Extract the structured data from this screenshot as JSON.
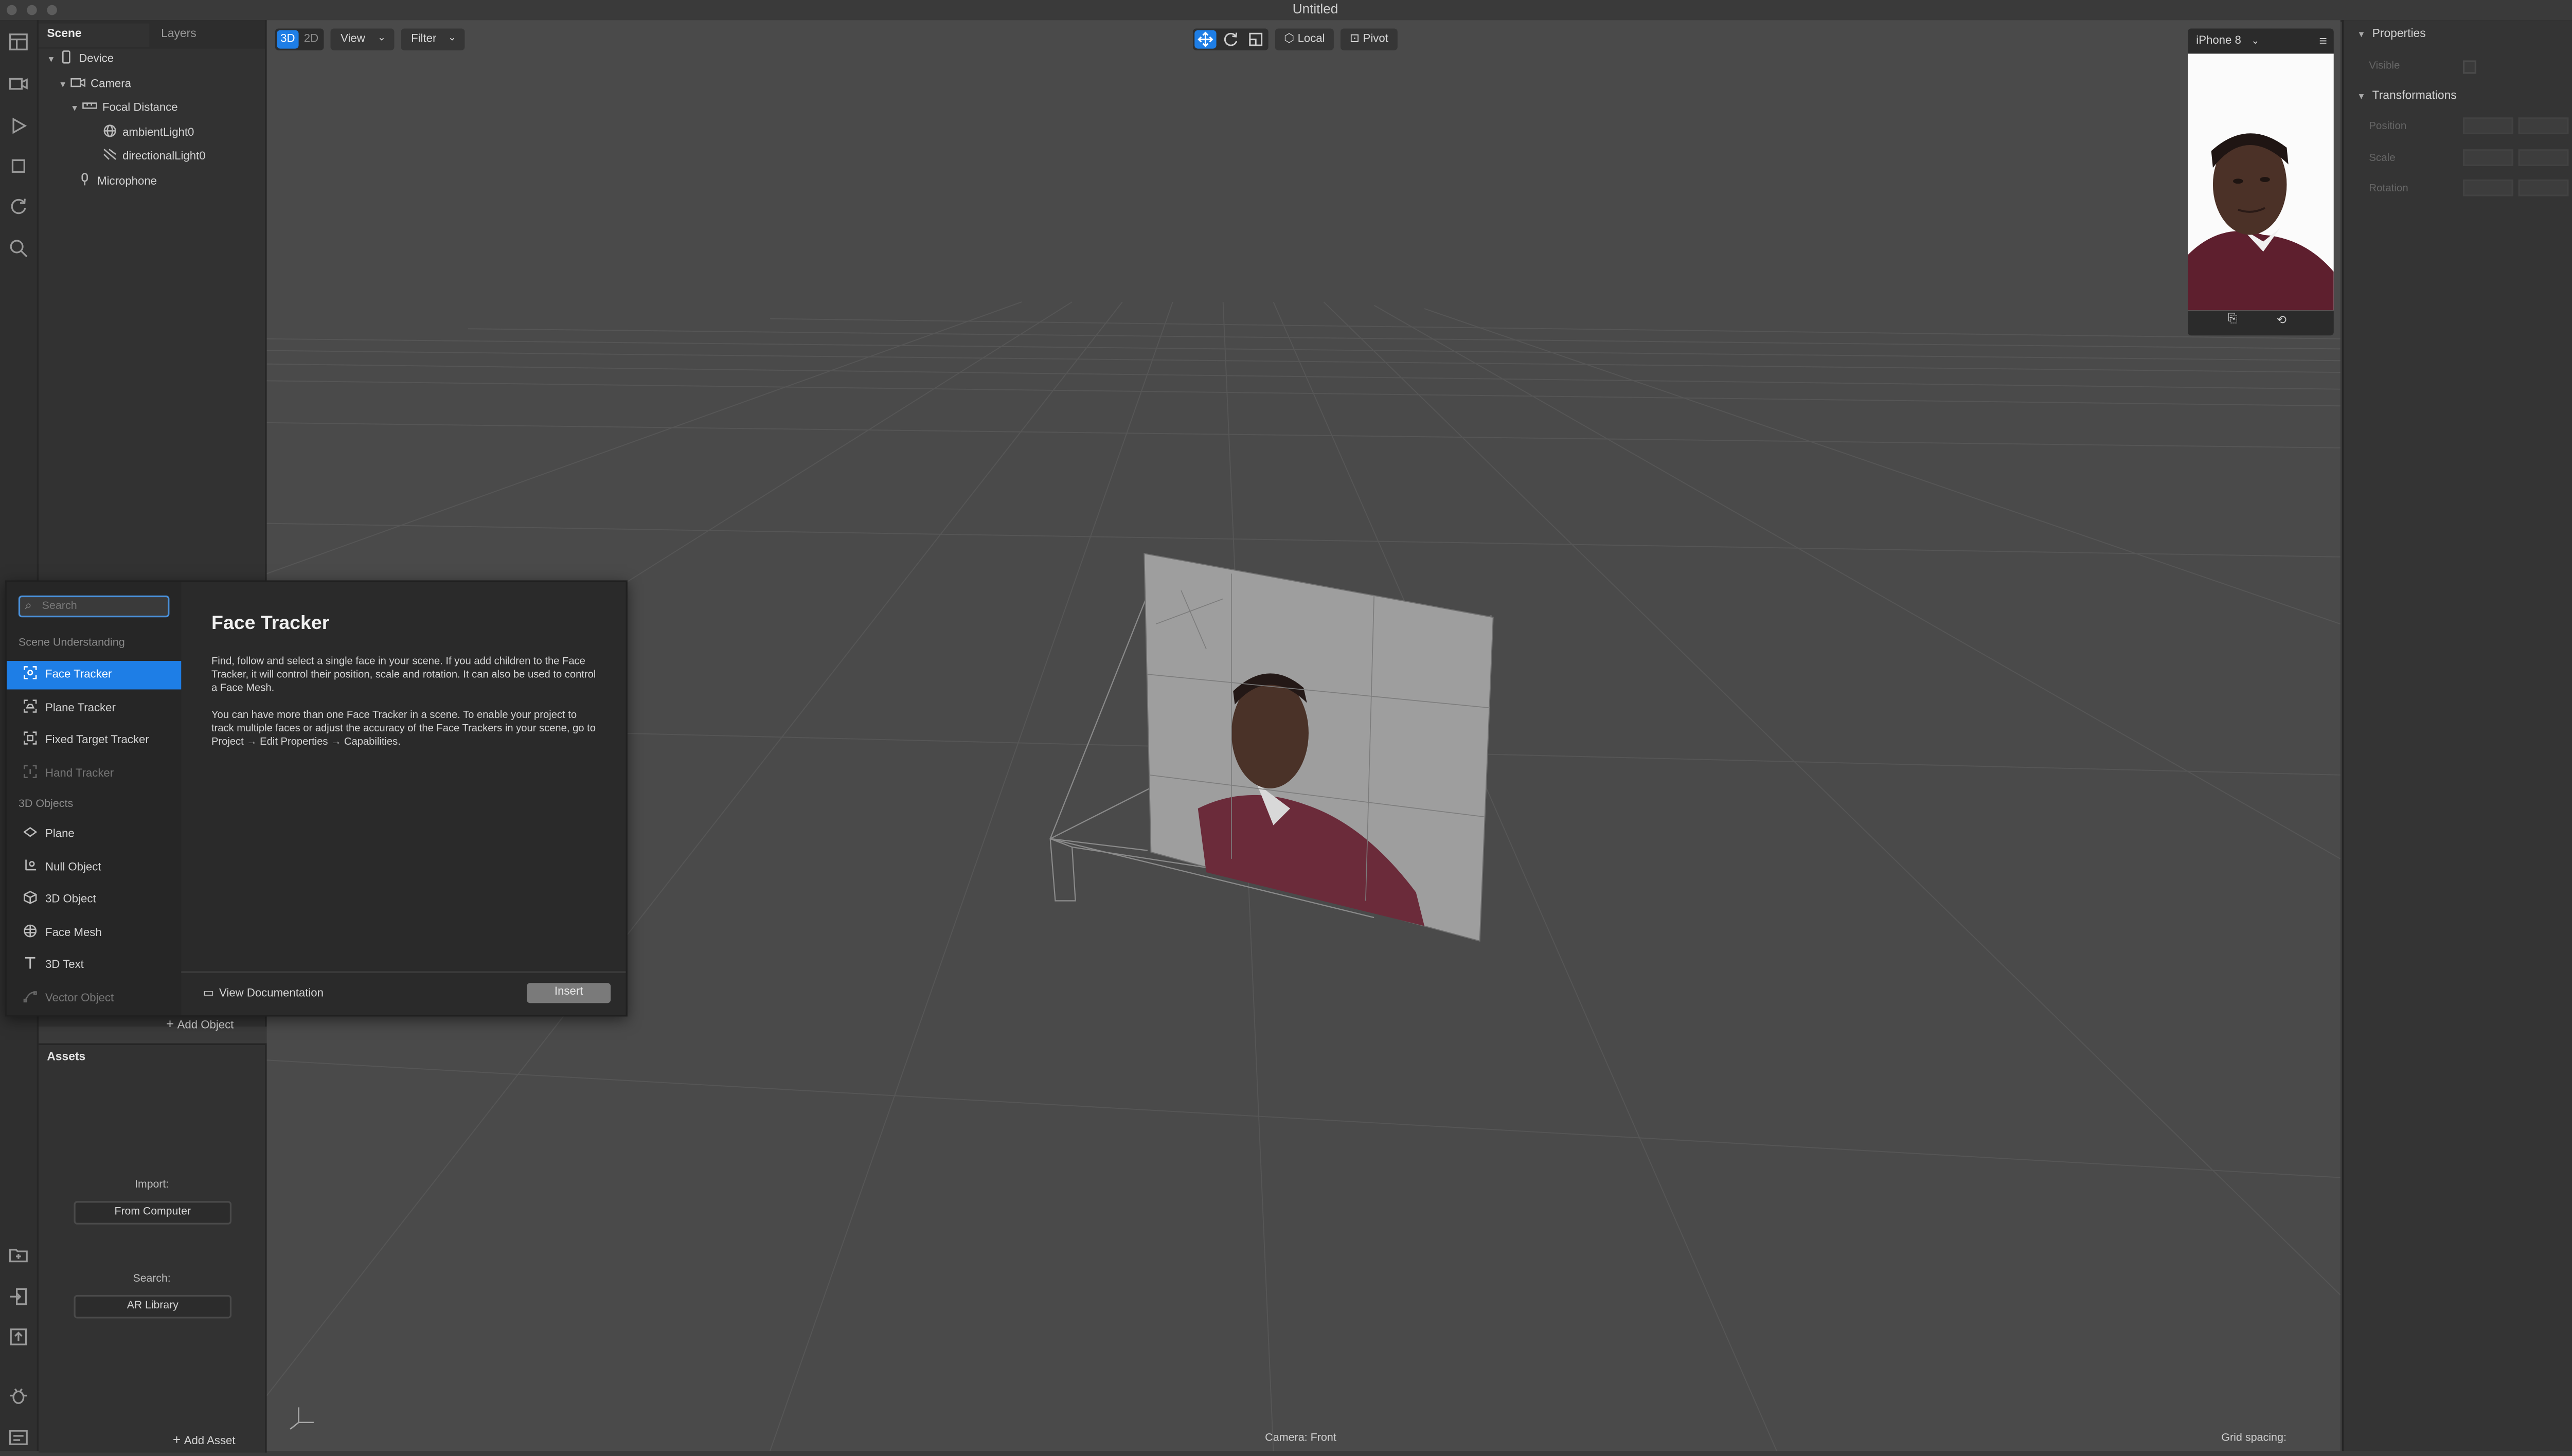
{
  "window": {
    "title": "Untitled"
  },
  "scene_panel": {
    "tabs": [
      "Scene",
      "Layers"
    ],
    "tree": [
      {
        "label": "Device",
        "icon": "phone-icon"
      },
      {
        "label": "Camera",
        "icon": "camera-icon"
      },
      {
        "label": "Focal Distance",
        "icon": "ruler-icon"
      },
      {
        "label": "ambientLight0",
        "icon": "ambient-light-icon"
      },
      {
        "label": "directionalLight0",
        "icon": "directional-light-icon"
      },
      {
        "label": "Microphone",
        "icon": "microphone-icon"
      }
    ],
    "add_object": "Add Object"
  },
  "assets_panel": {
    "title": "Assets",
    "import_label": "Import:",
    "import_button": "From Computer",
    "search_label": "Search:",
    "search_button": "AR Library",
    "add_asset": "Add Asset"
  },
  "viewport": {
    "mode_3d": "3D",
    "mode_2d": "2D",
    "view_menu": "View",
    "filter_menu": "Filter",
    "space_button": "Local",
    "pivot_button": "Pivot",
    "camera_status": "Camera: Front",
    "grid_status": "Grid spacing:"
  },
  "preview": {
    "device": "iPhone 8"
  },
  "properties": {
    "section_properties": "Properties",
    "visible_label": "Visible",
    "section_transformations": "Transformations",
    "rows": [
      "Position",
      "Scale",
      "Rotation"
    ]
  },
  "insert_popup": {
    "search_placeholder": "Search",
    "category_scene": "Scene Understanding",
    "scene_items": [
      {
        "label": "Face Tracker",
        "icon": "face-tracker-icon",
        "selected": true
      },
      {
        "label": "Plane Tracker",
        "icon": "plane-tracker-icon"
      },
      {
        "label": "Fixed Target Tracker",
        "icon": "target-tracker-icon"
      },
      {
        "label": "Hand Tracker",
        "icon": "hand-tracker-icon",
        "disabled": true
      }
    ],
    "category_3d": "3D Objects",
    "object_items": [
      {
        "label": "Plane",
        "icon": "plane-icon"
      },
      {
        "label": "Null Object",
        "icon": "null-object-icon"
      },
      {
        "label": "3D Object",
        "icon": "cube-icon"
      },
      {
        "label": "Face Mesh",
        "icon": "face-mesh-icon"
      },
      {
        "label": "3D Text",
        "icon": "text-icon"
      },
      {
        "label": "Vector Object",
        "icon": "vector-icon",
        "disabled": true
      }
    ],
    "detail_title": "Face Tracker",
    "detail_p1": "Find, follow and select a single face in your scene. If you add children to the Face Tracker, it will control their position, scale and rotation. It can also be used to control a Face Mesh.",
    "detail_p2": "You can have more than one Face Tracker in a scene. To enable your project to track multiple faces or adjust the accuracy of the Face Trackers in your scene, go to Project → Edit Properties → Capabilities.",
    "view_docs": "View Documentation",
    "insert_button": "Insert"
  },
  "colors": {
    "accent": "#1e7ee6",
    "viewport_bg": "#4a4a4a",
    "panel_bg": "#323232"
  }
}
